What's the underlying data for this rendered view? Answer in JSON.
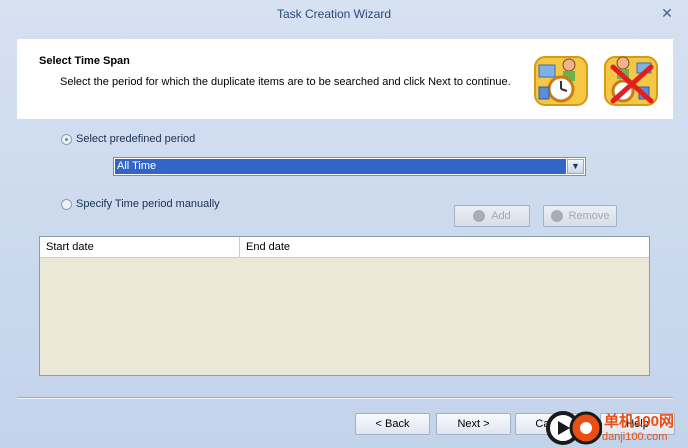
{
  "window": {
    "title": "Task Creation Wizard"
  },
  "header": {
    "title": "Select Time Span",
    "subtitle": "Select the period for which the duplicate items are to be searched and click Next to continue."
  },
  "options": {
    "predefined_label": "Select predefined period",
    "manual_label": "Specify Time period manually",
    "selected": "predefined"
  },
  "period_select": {
    "value": "All Time"
  },
  "buttons": {
    "add": "Add",
    "remove": "Remove",
    "back": "< Back",
    "next": "Next >",
    "cancel": "Cancel",
    "help": "Help"
  },
  "table": {
    "columns": [
      "Start date",
      "End date"
    ],
    "rows": []
  },
  "watermark": {
    "cn": "单机100网",
    "en": "danji100.com"
  },
  "colors": {
    "accent": "#3165c7",
    "watermark": "#e94f12"
  }
}
